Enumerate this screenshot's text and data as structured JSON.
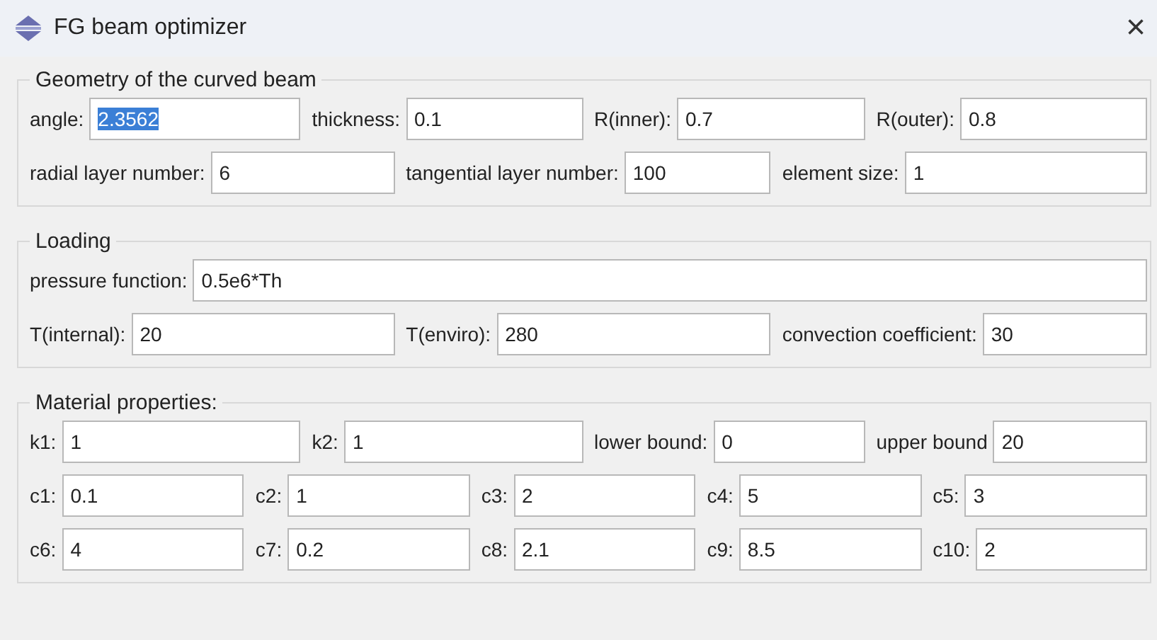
{
  "window": {
    "title": "FG beam optimizer",
    "close": "×"
  },
  "groups": [
    {
      "title": "Geometry of the curved beam",
      "lines": [
        {
          "fields": [
            {
              "label": "angle:",
              "value": "2.3562",
              "highlighted": true,
              "kind": "normal"
            },
            {
              "label": "thickness:",
              "value": "0.1",
              "highlighted": false,
              "kind": "normal"
            },
            {
              "label": "R(inner):",
              "value": "0.7",
              "highlighted": false,
              "kind": "normal"
            },
            {
              "label": "R(outer):",
              "value": "0.8",
              "highlighted": false,
              "kind": "normal"
            }
          ]
        },
        {
          "fields": [
            {
              "label": "radial layer number:",
              "value": "6",
              "highlighted": false,
              "kind": "normal"
            },
            {
              "label": "tangential layer number:",
              "value": "100",
              "highlighted": false,
              "kind": "normal"
            },
            {
              "label": "element size:",
              "value": "1",
              "highlighted": false,
              "kind": "normal"
            }
          ]
        }
      ]
    },
    {
      "title": "Loading",
      "lines": [
        {
          "fields": [
            {
              "label": "pressure function:",
              "value": "0.5e6*Th",
              "highlighted": false,
              "kind": "wide"
            }
          ]
        },
        {
          "fields": [
            {
              "label": "T(internal):",
              "value": "20",
              "highlighted": false,
              "kind": "normal"
            },
            {
              "label": "T(enviro):",
              "value": "280",
              "highlighted": false,
              "kind": "normal"
            },
            {
              "label": "convection coefficient:",
              "value": "30",
              "highlighted": false,
              "kind": "normal"
            }
          ]
        }
      ]
    },
    {
      "title": "Material properties:",
      "lines": [
        {
          "fields": [
            {
              "label": "k1:",
              "value": "1",
              "highlighted": false,
              "kind": "normal"
            },
            {
              "label": "k2:",
              "value": "1",
              "highlighted": false,
              "kind": "normal"
            },
            {
              "label": "lower bound:",
              "value": "0",
              "highlighted": false,
              "kind": "normal"
            },
            {
              "label": "upper bound",
              "value": "20",
              "highlighted": false,
              "kind": "normal"
            }
          ]
        },
        {
          "fields": [
            {
              "label": "c1:",
              "value": "0.1",
              "highlighted": false,
              "kind": "normal"
            },
            {
              "label": "c2:",
              "value": "1",
              "highlighted": false,
              "kind": "normal"
            },
            {
              "label": "c3:",
              "value": "2",
              "highlighted": false,
              "kind": "normal"
            },
            {
              "label": "c4:",
              "value": "5",
              "highlighted": false,
              "kind": "normal"
            },
            {
              "label": "c5:",
              "value": "3",
              "highlighted": false,
              "kind": "normal"
            }
          ]
        },
        {
          "fields": [
            {
              "label": "c6:",
              "value": "4",
              "highlighted": false,
              "kind": "normal"
            },
            {
              "label": "c7:",
              "value": "0.2",
              "highlighted": false,
              "kind": "normal"
            },
            {
              "label": "c8:",
              "value": "2.1",
              "highlighted": false,
              "kind": "normal"
            },
            {
              "label": "c9:",
              "value": "8.5",
              "highlighted": false,
              "kind": "normal"
            },
            {
              "label": "c10:",
              "value": "2",
              "highlighted": false,
              "kind": "normal"
            }
          ]
        }
      ]
    }
  ]
}
